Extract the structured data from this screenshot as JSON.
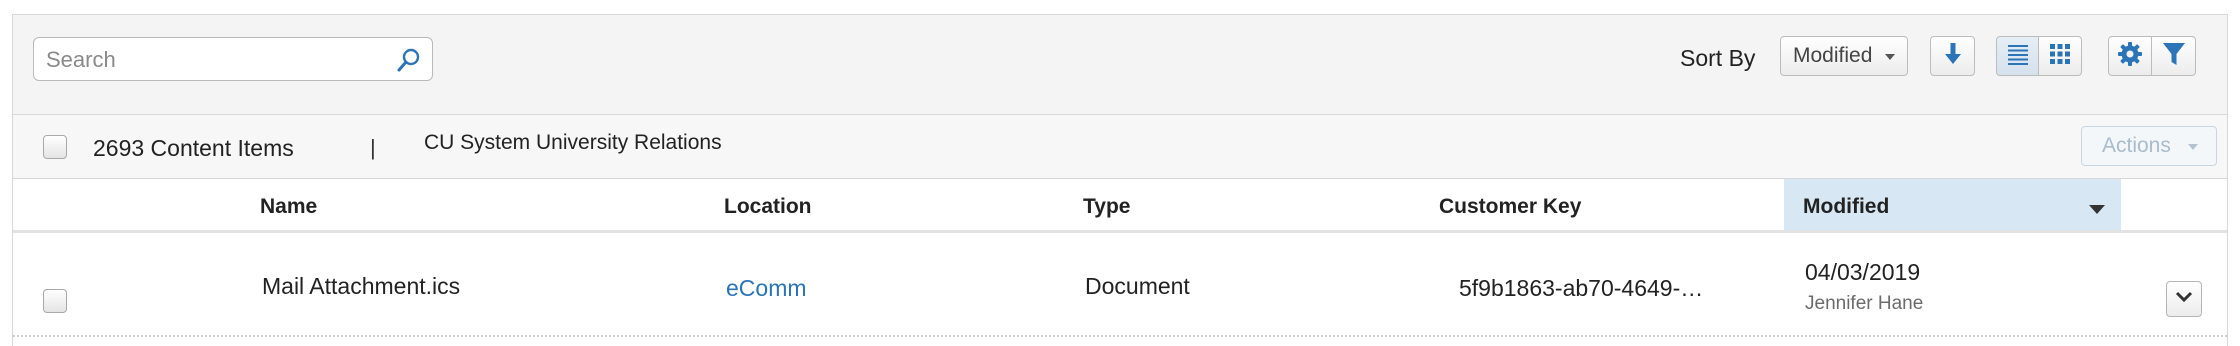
{
  "toolbar": {
    "search_placeholder": "Search",
    "sort_by_label": "Sort By",
    "sort_selected": "Modified",
    "accent_color": "#2b74b8"
  },
  "selection_bar": {
    "count_label": "2693 Content Items",
    "separator": "|",
    "folder_name": "CU System University Relations",
    "actions_label": "Actions"
  },
  "table": {
    "columns": [
      {
        "label": "Name"
      },
      {
        "label": "Location"
      },
      {
        "label": "Type"
      },
      {
        "label": "Customer Key"
      },
      {
        "label": "Modified",
        "sorted": "descending"
      }
    ],
    "rows": [
      {
        "name": "Mail Attachment.ics",
        "location": "eComm",
        "type": "Document",
        "customer_key": "5f9b1863-ab70-4649-…",
        "modified_date": "04/03/2019",
        "modified_by": "Jennifer Hane"
      }
    ]
  },
  "icons": {
    "search": "search-icon",
    "sort_direction": "arrow-down-icon",
    "list_view": "list-view-icon",
    "grid_view": "grid-view-icon",
    "settings": "gear-icon",
    "filter": "filter-icon",
    "row_menu": "chevron-down-icon"
  }
}
